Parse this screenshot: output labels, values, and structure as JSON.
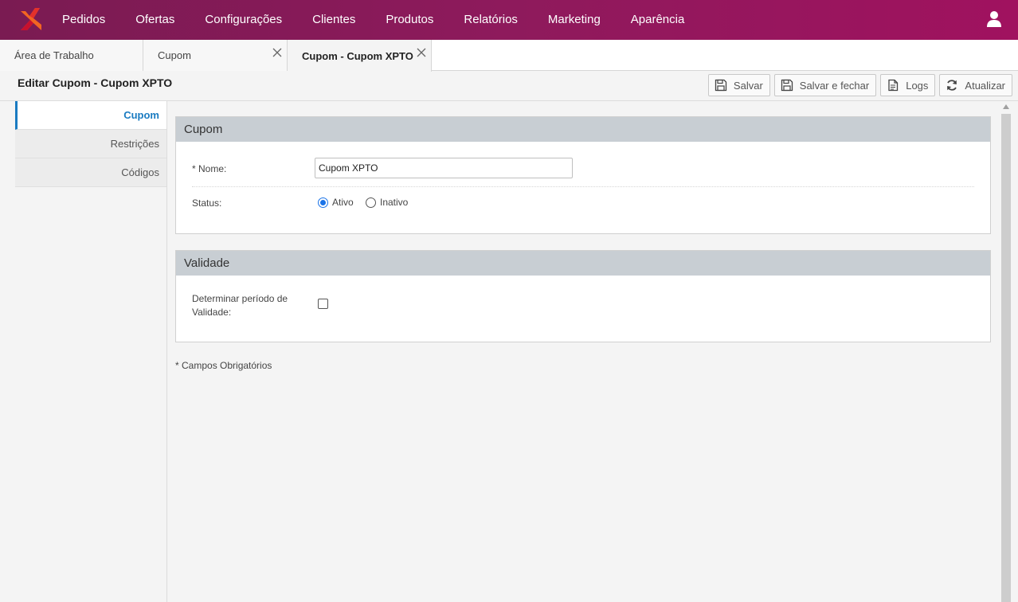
{
  "topbar": {
    "nav": [
      "Pedidos",
      "Ofertas",
      "Configurações",
      "Clientes",
      "Produtos",
      "Relatórios",
      "Marketing",
      "Aparência"
    ],
    "brand_colors": {
      "left": "#7a1b52",
      "right": "#a0125f",
      "logo_orange": "#f26522",
      "logo_red": "#e4312b"
    }
  },
  "tabs": [
    {
      "label": "Área de Trabalho",
      "closable": false,
      "active": false
    },
    {
      "label": "Cupom",
      "closable": true,
      "active": false
    },
    {
      "label": "Cupom - Cupom XPTO",
      "closable": true,
      "active": true
    }
  ],
  "page": {
    "title": "Editar Cupom - Cupom XPTO"
  },
  "toolbar": {
    "save": "Salvar",
    "save_close": "Salvar e fechar",
    "logs": "Logs",
    "refresh": "Atualizar"
  },
  "sidemenu": {
    "items": [
      "Cupom",
      "Restrições",
      "Códigos"
    ],
    "active_index": 0,
    "accent": "#1a7bc1"
  },
  "cupom_panel": {
    "title": "Cupom",
    "name_label": "* Nome:",
    "name_value": "Cupom XPTO",
    "status_label": "Status:",
    "status_options": [
      "Ativo",
      "Inativo"
    ],
    "status_selected": "Ativo"
  },
  "validade_panel": {
    "title": "Validade",
    "period_label_line1": "Determinar período de",
    "period_label_line2": "Validade:",
    "period_checked": false
  },
  "footer_note": "* Campos Obrigatórios"
}
